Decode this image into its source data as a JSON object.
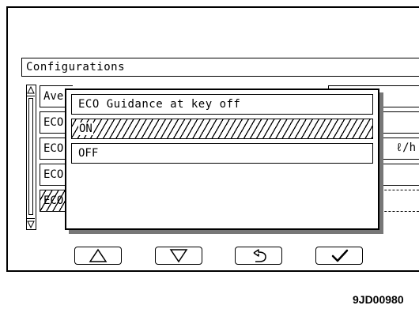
{
  "screen": {
    "title": "Configurations",
    "background_rows": [
      {
        "label": "Ave",
        "selected": false
      },
      {
        "label": "ECO",
        "selected": false
      },
      {
        "label": "ECO",
        "selected": false
      },
      {
        "label": "ECO",
        "selected": false
      },
      {
        "label": "ECO",
        "selected": true
      }
    ],
    "right_values": [
      "",
      "",
      "ℓ/h",
      "",
      ""
    ],
    "scroll_up_icon": "triangle-up-small",
    "scroll_down_icon": "triangle-down-small"
  },
  "dialog": {
    "title": "ECO Guidance at key off",
    "options": [
      {
        "label": "ON",
        "selected": true
      },
      {
        "label": "OFF",
        "selected": false
      }
    ]
  },
  "footer_buttons": [
    {
      "icon": "up-triangle-icon"
    },
    {
      "icon": "down-triangle-icon"
    },
    {
      "icon": "return-arrow-icon"
    },
    {
      "icon": "check-icon"
    }
  ],
  "figure_code": "9JD00980"
}
